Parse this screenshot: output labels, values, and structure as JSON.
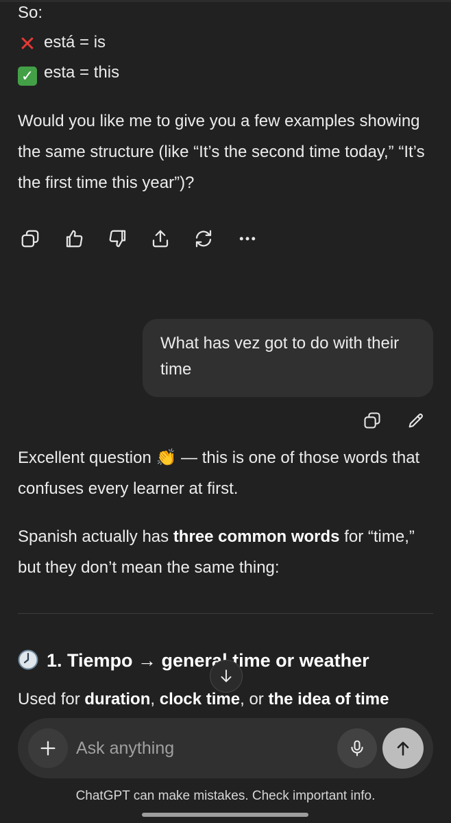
{
  "prev_answer": {
    "so_line": "So:",
    "wrong_line": "está = is",
    "right_line": "esta = this",
    "followup": "Would you like me to give you a few examples showing the same structure (like “It’s the second time today,” “It’s the first time this year”)?"
  },
  "user_message": {
    "text": "What has vez got to do with their time"
  },
  "answer": {
    "intro_prefix": "Excellent question ",
    "intro_emoji": "👏",
    "intro_suffix": " — this is one of those words that confuses every learner at first.",
    "p2_prefix": "Spanish actually has ",
    "p2_bold": "three common words",
    "p2_suffix": " for “time,” but they don’t mean the same thing:",
    "heading": "1. Tiempo → general time or weather",
    "used_for_prefix": "Used for ",
    "used_for_bold1": "duration",
    "used_for_sep1": ", ",
    "used_for_bold2": "clock time",
    "used_for_sep2": ", or ",
    "used_for_bold3": "the idea of time"
  },
  "composer": {
    "placeholder": "Ask anything"
  },
  "footer": {
    "disclaimer": "ChatGPT can make mistakes. Check important info."
  },
  "icons": {
    "wrong": "cross-mark-icon",
    "right": "check-mark-icon",
    "clock": "clock-icon",
    "actions": [
      "copy-icon",
      "thumbs-up-icon",
      "thumbs-down-icon",
      "share-icon",
      "regenerate-icon",
      "more-icon"
    ],
    "user_actions": [
      "copy-icon",
      "edit-icon"
    ]
  }
}
